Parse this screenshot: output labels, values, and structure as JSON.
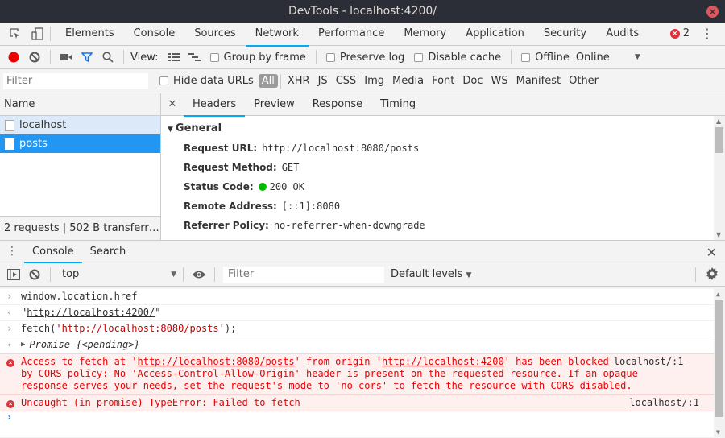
{
  "window": {
    "title": "DevTools - localhost:4200/"
  },
  "main_tabs": [
    "Elements",
    "Console",
    "Sources",
    "Network",
    "Performance",
    "Memory",
    "Application",
    "Security",
    "Audits"
  ],
  "active_tab": "Network",
  "error_count": "2",
  "network_toolbar": {
    "view_label": "View:",
    "group_by_frame": "Group by frame",
    "preserve_log": "Preserve log",
    "disable_cache": "Disable cache",
    "offline": "Offline",
    "throttle": "Online"
  },
  "filter_bar": {
    "placeholder": "Filter",
    "hide_data_urls": "Hide data URLs",
    "types": [
      "All",
      "XHR",
      "JS",
      "CSS",
      "Img",
      "Media",
      "Font",
      "Doc",
      "WS",
      "Manifest",
      "Other"
    ]
  },
  "request_list": {
    "header": "Name",
    "rows": [
      "localhost",
      "posts"
    ],
    "selected": "posts",
    "status": "2 requests  |  502 B transferr…"
  },
  "detail_tabs": [
    "Headers",
    "Preview",
    "Response",
    "Timing"
  ],
  "general": {
    "title": "General",
    "rows": [
      {
        "key": "Request URL:",
        "value": "http://localhost:8080/posts"
      },
      {
        "key": "Request Method:",
        "value": "GET"
      },
      {
        "key": "Status Code:",
        "value": "200 OK"
      },
      {
        "key": "Remote Address:",
        "value": "[::1]:8080"
      },
      {
        "key": "Referrer Policy:",
        "value": "no-referrer-when-downgrade"
      }
    ]
  },
  "drawer": {
    "tabs": [
      "Console",
      "Search"
    ],
    "context": "top",
    "filter_placeholder": "Filter",
    "levels": "Default levels"
  },
  "console": {
    "lines": {
      "l1": "window.location.href",
      "l2_q1": "\"",
      "l2_url": "http://localhost:4200/",
      "l2_q2": "\"",
      "l3_a": "fetch(",
      "l3_str": "'http://localhost:8080/posts'",
      "l3_b": ");",
      "l4": "Promise {<pending>}"
    },
    "error1": {
      "a": "Access to fetch at '",
      "url1": "http://localhost:8080/posts",
      "b": "' from origin '",
      "url2": "http://localhost:4200",
      "c": "' has been blocked",
      "d": "by CORS policy: No 'Access-Control-Allow-Origin' header is present on the requested resource. If an opaque",
      "e": "response serves your needs, set the request's mode to 'no-cors' to fetch the resource with CORS disabled.",
      "source": "localhost/:1"
    },
    "error2": {
      "text": "Uncaught (in promise) TypeError: Failed to fetch",
      "source": "localhost/:1"
    },
    "prompt": "›"
  }
}
